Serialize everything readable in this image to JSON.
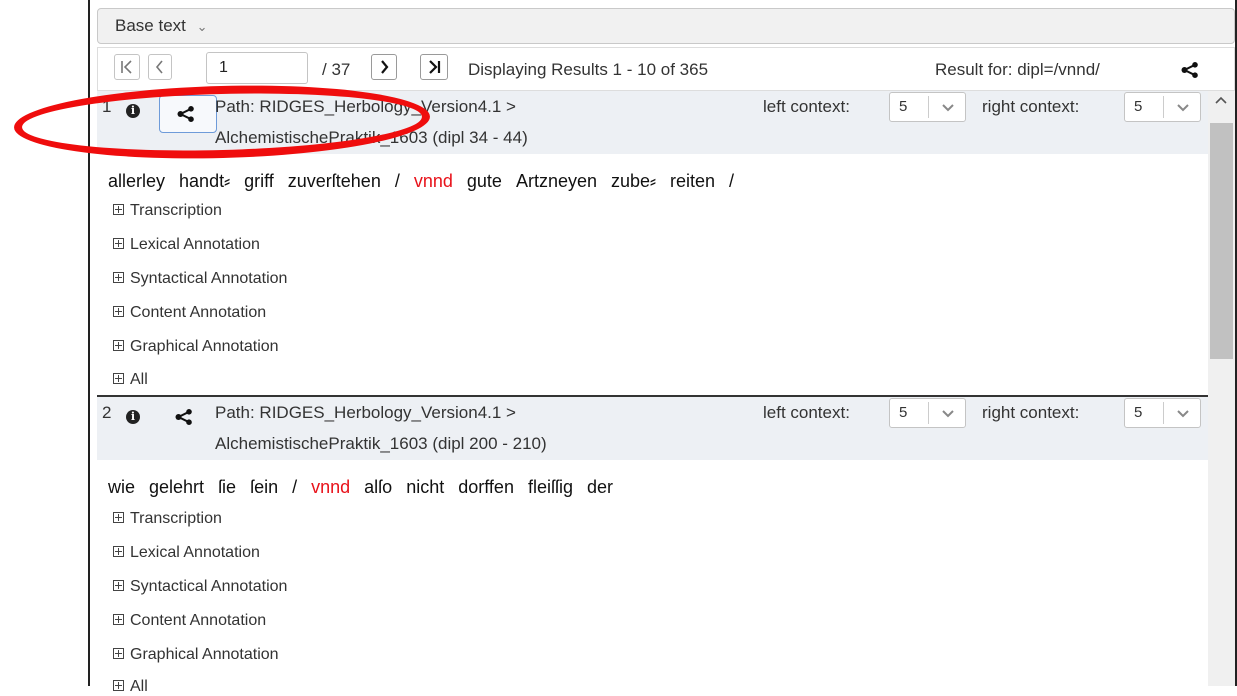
{
  "toolbar": {
    "base_text_label": "Base text",
    "base_text_chevron": "⌄"
  },
  "pagination": {
    "first_icon": "first-page-icon",
    "prev_icon": "chevron-left-icon",
    "current_page": "1",
    "total_pages": "/ 37",
    "next_icon": "chevron-right-icon",
    "last_icon": "last-page-icon",
    "summary": "Displaying Results 1 - 10 of 365",
    "result_for": "Result for: dipl=/vnnd/"
  },
  "results": [
    {
      "number": "1",
      "path_line1": "Path: RIDGES_Herbology_Version4.1 >",
      "path_line2": "AlchemistischePraktik_1603 (dipl 34 - 44)",
      "left_context_label": "left context:",
      "left_context_value": "5",
      "right_context_label": "right context:",
      "right_context_value": "5",
      "tokens": [
        "allerley",
        "handt⸗",
        "griff",
        "zuverſtehen",
        "/",
        "vnnd",
        "gute",
        "Artzneyen",
        "zube⸗",
        "reiten",
        "/"
      ],
      "match_index": 5,
      "annotations": [
        "Transcription",
        "Lexical Annotation",
        "Syntactical Annotation",
        "Content Annotation",
        "Graphical Annotation",
        "All"
      ]
    },
    {
      "number": "2",
      "path_line1": "Path: RIDGES_Herbology_Version4.1 >",
      "path_line2": "AlchemistischePraktik_1603 (dipl 200 - 210)",
      "left_context_label": "left context:",
      "left_context_value": "5",
      "right_context_label": "right context:",
      "right_context_value": "5",
      "tokens": [
        "wie",
        "gelehrt",
        "ſie",
        "ſein",
        "/",
        "vnnd",
        "alſo",
        "nicht",
        "dorffen",
        "fleiſſig",
        "der"
      ],
      "match_index": 5,
      "annotations": [
        "Transcription",
        "Lexical Annotation",
        "Syntactical Annotation",
        "Content Annotation",
        "Graphical Annotation",
        "All"
      ]
    }
  ],
  "colors": {
    "match": "#e8121a",
    "highlight_ring": "#ef0d0d",
    "header_bg": "#edf0f4"
  }
}
